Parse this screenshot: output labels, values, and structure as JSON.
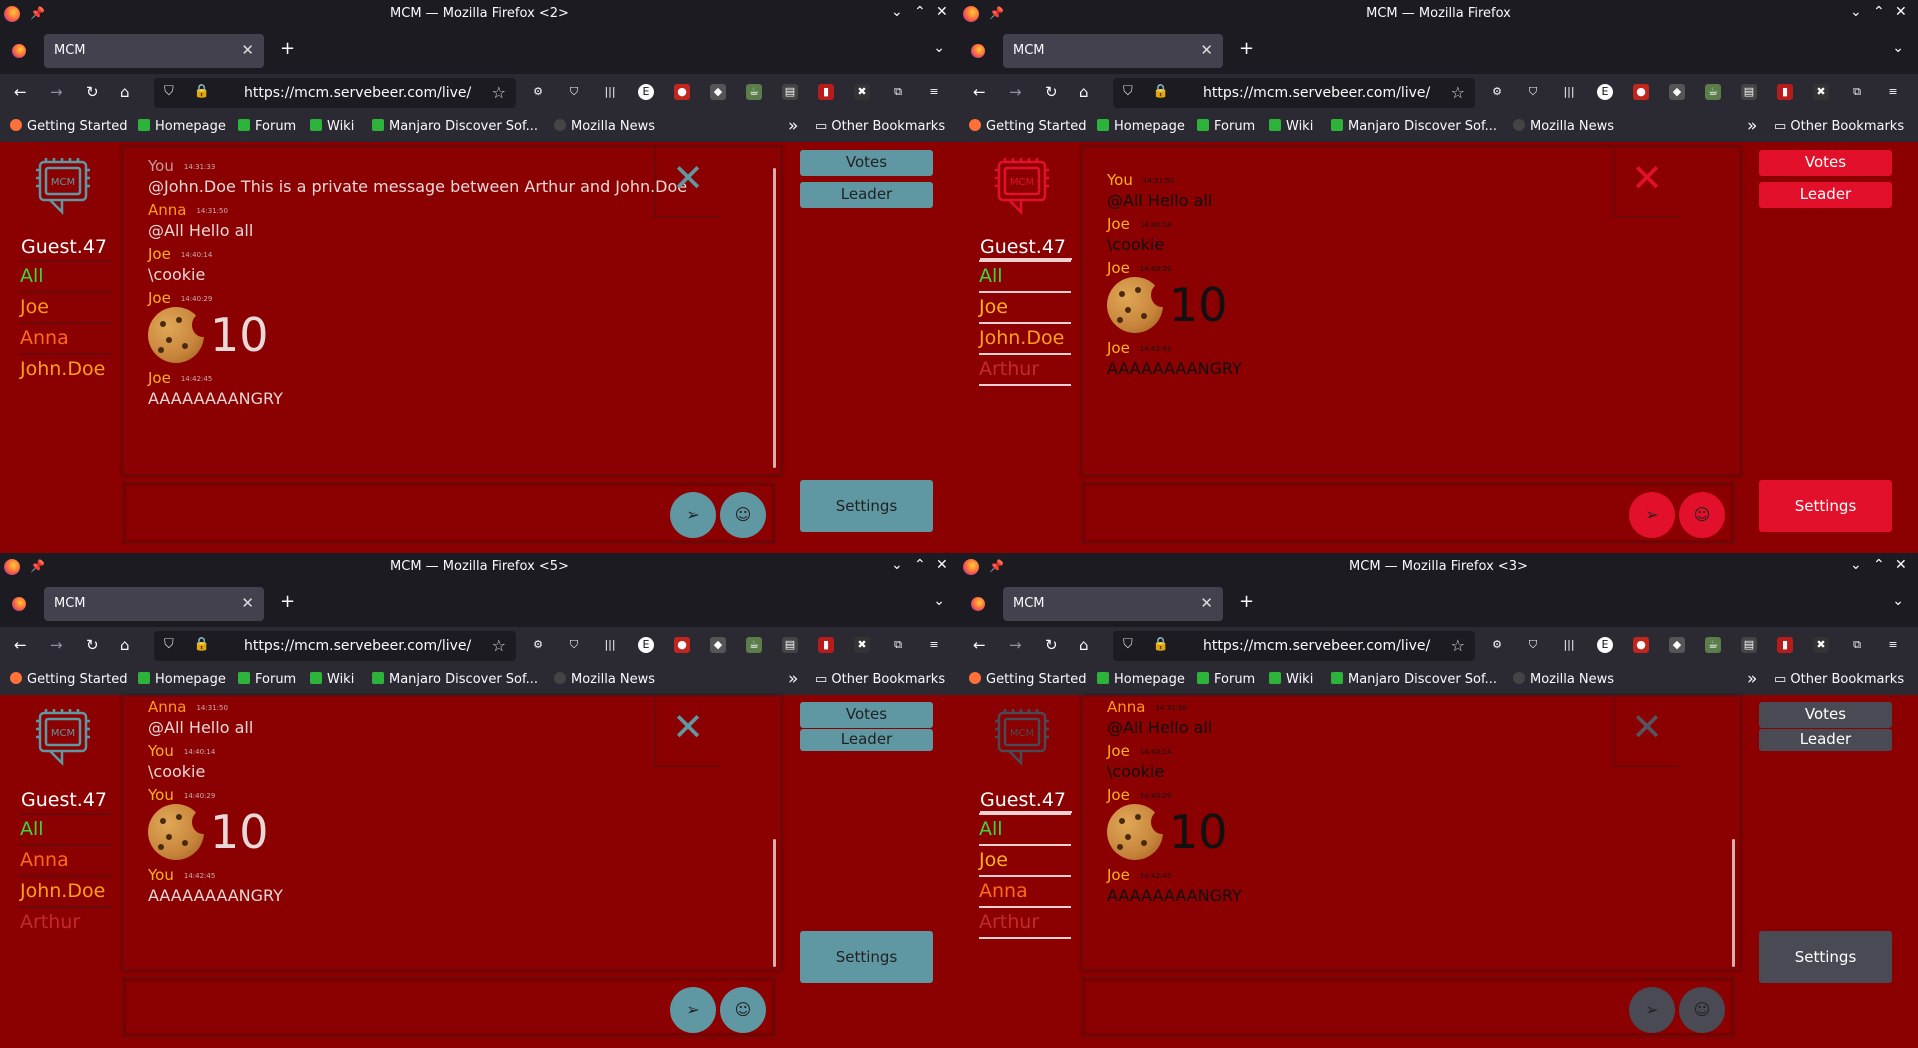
{
  "browser": {
    "tab_label": "MCM",
    "url": "https://mcm.servebeer.com/live/",
    "bookmarks": [
      "Getting Started",
      "Homepage",
      "Forum",
      "Wiki",
      "Manjaro Discover Sof...",
      "Mozilla News"
    ],
    "other_bookmarks": "Other Bookmarks"
  },
  "app": {
    "logo_text": "MCM",
    "votes_label": "Votes",
    "leader_label": "Leader",
    "settings_label": "Settings",
    "close_glyph": "✕"
  },
  "windows": [
    {
      "title": "MCM — Mozilla Firefox <2>",
      "theme": {
        "accent": "#5f98a3",
        "text": "#ffffff",
        "muted": "#c9b0b0",
        "closecolor": "#5f98a3"
      },
      "username": "Guest.47",
      "users": [
        {
          "name": "All",
          "color": "#3dd63d"
        },
        {
          "name": "Joe",
          "color": "#ff9a1a"
        },
        {
          "name": "Anna",
          "color": "#ff6a1a"
        },
        {
          "name": "John.Doe",
          "color": "#ffa01a"
        }
      ],
      "messages": [
        {
          "who": "You",
          "time": "14:31:33",
          "text": "@John.Doe This is a private message between Arthur and John.Doe",
          "whocolor": "#c79b9b"
        },
        {
          "who": "Anna",
          "time": "14:31:50",
          "text": "@All Hello all",
          "whocolor": "#ff9a1a"
        },
        {
          "who": "Joe",
          "time": "14:40:14",
          "text": "\\cookie",
          "whocolor": "#ffb21a"
        },
        {
          "who": "Joe",
          "time": "14:40:29",
          "cookie": "10",
          "whocolor": "#ffb21a"
        },
        {
          "who": "Joe",
          "time": "14:42:45",
          "text": "AAAAAAAANGRY",
          "whocolor": "#ffb21a"
        }
      ]
    },
    {
      "title": "MCM — Mozilla Firefox",
      "theme": {
        "accent": "#e2102a",
        "text": "#111111",
        "muted": "#111111",
        "closecolor": "#e2102a"
      },
      "username": "Guest.47",
      "users": [
        {
          "name": "All",
          "color": "#3dd63d"
        },
        {
          "name": "Joe",
          "color": "#ffb21a"
        },
        {
          "name": "John.Doe",
          "color": "#ffa01a"
        },
        {
          "name": "Arthur",
          "color": "#c32b2b"
        }
      ],
      "messages": [
        {
          "who": "You",
          "time": "14:31:50",
          "text": "@All Hello all",
          "whocolor": "#ffb21a"
        },
        {
          "who": "Joe",
          "time": "14:40:14",
          "text": "\\cookie",
          "whocolor": "#ffb21a"
        },
        {
          "who": "Joe",
          "time": "14:40:29",
          "cookie": "10",
          "whocolor": "#ffb21a"
        },
        {
          "who": "Joe",
          "time": "14:42:45",
          "text": "AAAAAAAANGRY",
          "whocolor": "#ffb21a"
        }
      ]
    },
    {
      "title": "MCM — Mozilla Firefox <5>",
      "theme": {
        "accent": "#5f98a3",
        "text": "#ffffff",
        "muted": "#c9b0b0",
        "closecolor": "#5f98a3"
      },
      "username": "Guest.47",
      "users": [
        {
          "name": "All",
          "color": "#3dd63d"
        },
        {
          "name": "Anna",
          "color": "#ff6a1a"
        },
        {
          "name": "John.Doe",
          "color": "#ffa01a"
        },
        {
          "name": "Arthur",
          "color": "#c32b2b"
        }
      ],
      "messages": [
        {
          "who": "Anna",
          "time": "14:31:50",
          "text": "@All Hello all",
          "whocolor": "#ff9a1a"
        },
        {
          "who": "You",
          "time": "14:40:14",
          "text": "\\cookie",
          "whocolor": "#ffb21a"
        },
        {
          "who": "You",
          "time": "14:40:29",
          "cookie": "10",
          "whocolor": "#ffb21a"
        },
        {
          "who": "You",
          "time": "14:42:45",
          "text": "AAAAAAAANGRY",
          "whocolor": "#ffb21a"
        }
      ]
    },
    {
      "title": "MCM — Mozilla Firefox <3>",
      "theme": {
        "accent": "#4a4a55",
        "text": "#111111",
        "muted": "#111111",
        "closecolor": "#555560"
      },
      "username": "Guest.47",
      "users": [
        {
          "name": "All",
          "color": "#3dd63d"
        },
        {
          "name": "Joe",
          "color": "#ffb21a"
        },
        {
          "name": "Anna",
          "color": "#ff6a1a"
        },
        {
          "name": "Arthur",
          "color": "#c32b2b"
        }
      ],
      "messages": [
        {
          "who": "Anna",
          "time": "14:31:50",
          "text": "@All Hello all",
          "whocolor": "#ff9a1a"
        },
        {
          "who": "Joe",
          "time": "14:40:14",
          "text": "\\cookie",
          "whocolor": "#ffb21a"
        },
        {
          "who": "Joe",
          "time": "14:40:29",
          "cookie": "10",
          "whocolor": "#ffb21a"
        },
        {
          "who": "Joe",
          "time": "14:42:45",
          "text": "AAAAAAAANGRY",
          "whocolor": "#ffb21a"
        }
      ]
    }
  ]
}
